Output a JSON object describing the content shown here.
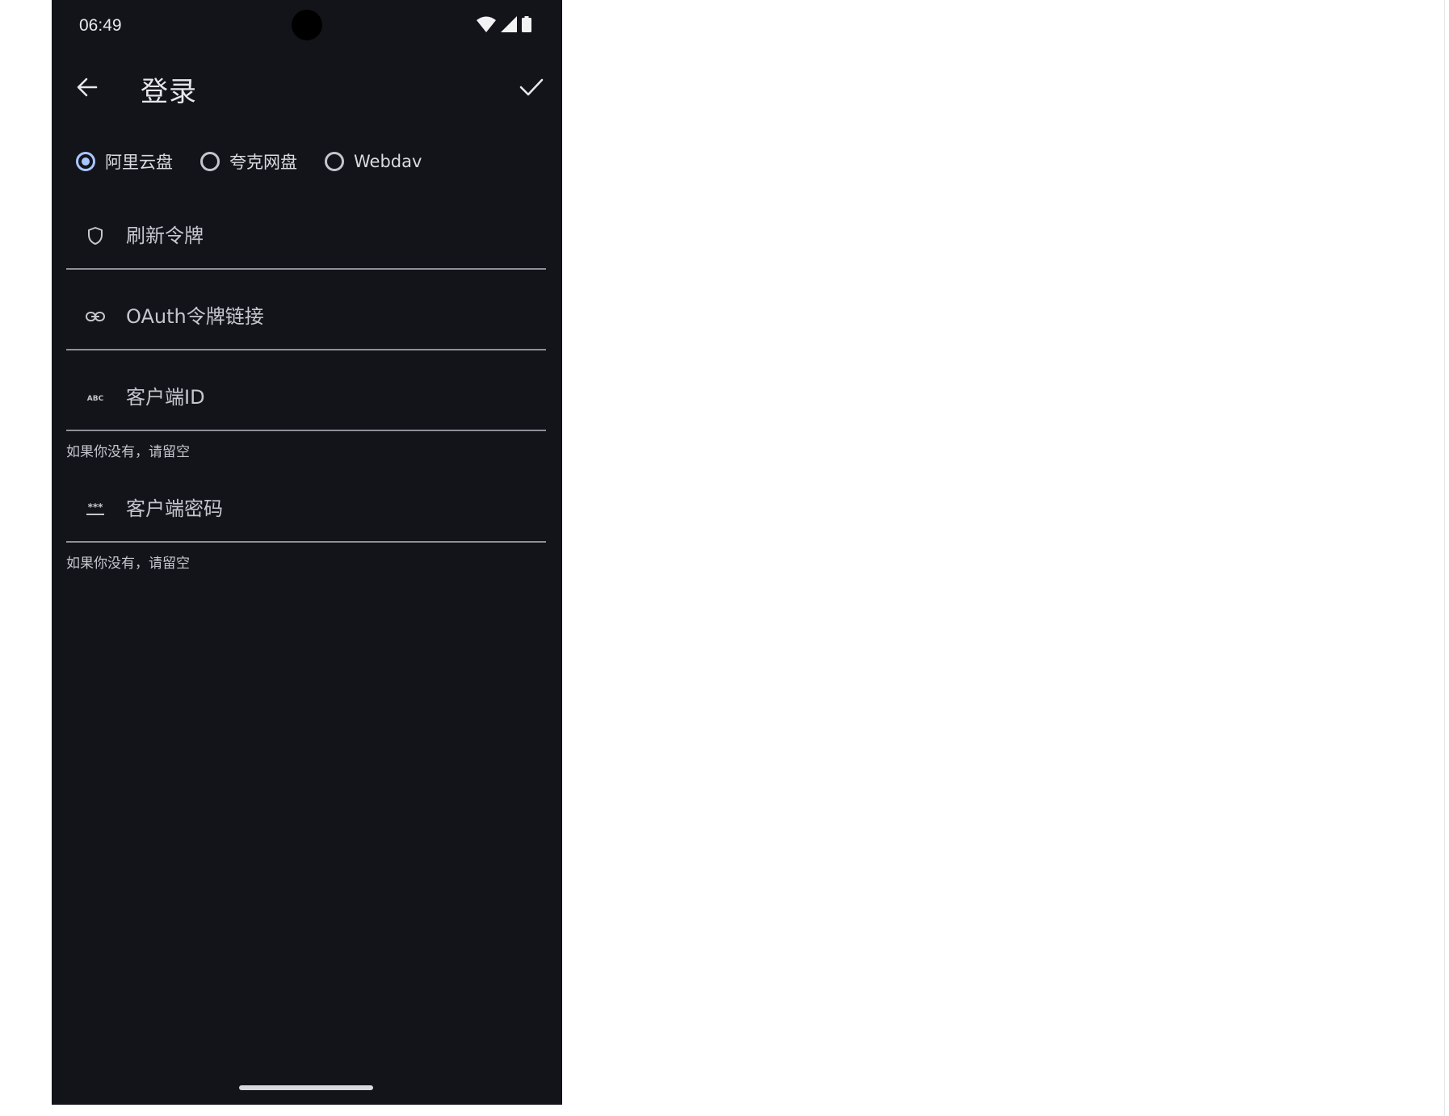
{
  "status_bar": {
    "time": "06:49"
  },
  "app_bar": {
    "title": "登录"
  },
  "login_type": {
    "options": [
      {
        "label": "阿里云盘",
        "selected": true
      },
      {
        "label": "夸克网盘",
        "selected": false
      },
      {
        "label": "Webdav",
        "selected": false
      }
    ]
  },
  "fields": {
    "refresh_token": {
      "placeholder": "刷新令牌",
      "value": ""
    },
    "oauth_link": {
      "placeholder": "OAuth令牌链接",
      "value": ""
    },
    "client_id": {
      "placeholder": "客户端ID",
      "value": "",
      "helper": "如果你没有，请留空"
    },
    "client_secret": {
      "placeholder": "客户端密码",
      "value": "",
      "helper": "如果你没有，请留空"
    }
  },
  "icons": {
    "back": "arrow-left-icon",
    "confirm": "check-icon",
    "refresh_token": "shield-icon",
    "oauth_link": "link-icon",
    "client_id": "abc-icon",
    "client_secret": "password-icon"
  },
  "colors": {
    "background": "#13141a",
    "accent": "#a9c7ff",
    "divider": "#8e9099"
  }
}
